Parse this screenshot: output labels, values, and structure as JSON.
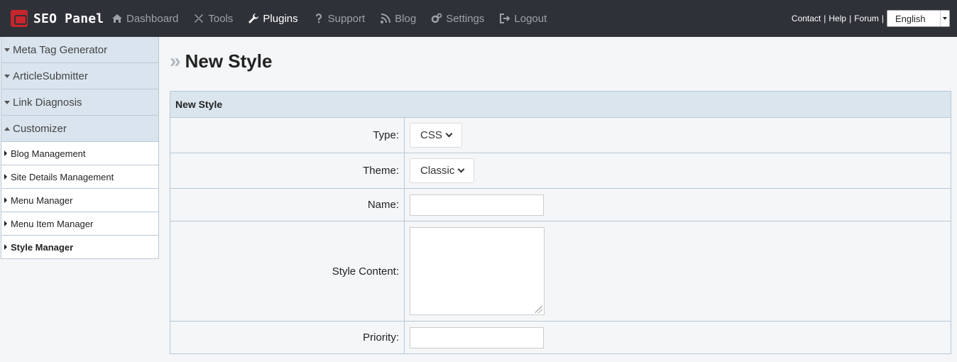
{
  "brand": {
    "name": "SEO Panel"
  },
  "nav": {
    "items": [
      {
        "label": "Dashboard",
        "icon": "dashboard-icon"
      },
      {
        "label": "Tools",
        "icon": "wrench-cross-icon"
      },
      {
        "label": "Plugins",
        "icon": "wrench-icon"
      },
      {
        "label": "Support",
        "icon": "question-icon"
      },
      {
        "label": "Blog",
        "icon": "rss-icon"
      },
      {
        "label": "Settings",
        "icon": "gears-icon"
      },
      {
        "label": "Logout",
        "icon": "logout-icon"
      }
    ],
    "active_index": 2
  },
  "top_links": {
    "contact": "Contact",
    "help": "Help",
    "forum": "Forum",
    "sep": "|"
  },
  "language": {
    "selected": "English"
  },
  "sidebar": {
    "sections": [
      {
        "label": "Meta Tag Generator",
        "expanded": false
      },
      {
        "label": "ArticleSubmitter",
        "expanded": false
      },
      {
        "label": "Link Diagnosis",
        "expanded": false
      },
      {
        "label": "Customizer",
        "expanded": true
      }
    ],
    "items": [
      {
        "label": "Blog Management"
      },
      {
        "label": "Site Details Management"
      },
      {
        "label": "Menu Manager"
      },
      {
        "label": "Menu Item Manager"
      },
      {
        "label": "Style Manager",
        "active": true
      }
    ]
  },
  "page": {
    "title": "New Style",
    "title_marker": "»"
  },
  "form": {
    "heading": "New Style",
    "type": {
      "label": "Type:",
      "value": "CSS"
    },
    "theme": {
      "label": "Theme:",
      "value": "Classic"
    },
    "name": {
      "label": "Name:",
      "value": ""
    },
    "style_content": {
      "label": "Style Content:",
      "value": ""
    },
    "priority": {
      "label": "Priority:",
      "value": ""
    }
  },
  "colors": {
    "navbar": "#2e3238",
    "nav_text": "#9da2a8",
    "brand_red": "#c8252c",
    "panel_head": "#dae5ee",
    "border": "#b9c9d7"
  }
}
